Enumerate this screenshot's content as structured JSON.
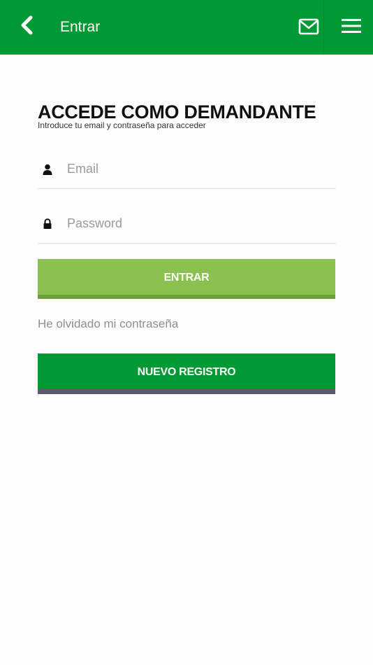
{
  "appbar": {
    "title": "Entrar",
    "back_icon": "chevron-left-icon",
    "mail_icon": "envelope-icon",
    "menu_icon": "hamburger-menu-icon",
    "background": "#009933"
  },
  "login": {
    "heading": "ACCEDE COMO DEMANDANTE",
    "subheading": "Introduce tu email y contraseña para acceder",
    "email": {
      "icon": "user-icon",
      "placeholder": "Email",
      "value": ""
    },
    "password": {
      "icon": "lock-icon",
      "placeholder": "Password",
      "value": ""
    },
    "submit_label": "ENTRAR",
    "forgot_label": "He olvidado mi contraseña",
    "register_label": "NUEVO REGISTRO"
  },
  "colors": {
    "primary_green": "#009933",
    "light_green": "#8cc152",
    "register_shadow": "#5a5a70"
  }
}
